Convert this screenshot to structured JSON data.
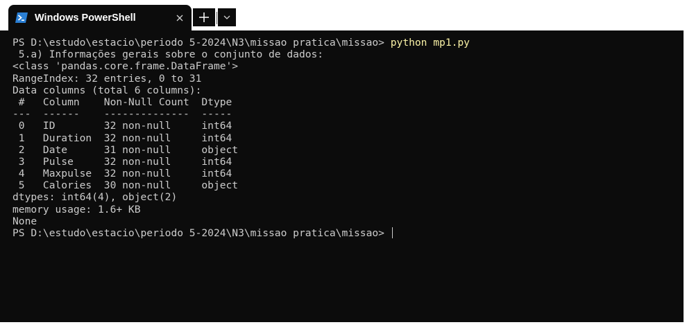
{
  "tab": {
    "title": "Windows PowerShell",
    "icon": "powershell-icon"
  },
  "colors": {
    "background": "#0c0c0c",
    "text": "#cccccc",
    "command": "#f9f1a5"
  },
  "terminal": {
    "prompt_path": "PS D:\\estudo\\estacio\\periodo 5-2024\\N3\\missao pratica\\missao> ",
    "command": "python mp1.py",
    "output": [
      " 5.a) Informações gerais sobre o conjunto de dados:",
      "<class 'pandas.core.frame.DataFrame'>",
      "RangeIndex: 32 entries, 0 to 31",
      "Data columns (total 6 columns):",
      " #   Column    Non-Null Count  Dtype ",
      "---  ------    --------------  ----- ",
      " 0   ID        32 non-null     int64 ",
      " 1   Duration  32 non-null     int64 ",
      " 2   Date      31 non-null     object",
      " 3   Pulse     32 non-null     int64 ",
      " 4   Maxpulse  32 non-null     int64 ",
      " 5   Calories  30 non-null     object",
      "dtypes: int64(4), object(2)",
      "memory usage: 1.6+ KB",
      "None"
    ],
    "final_prompt": "PS D:\\estudo\\estacio\\periodo 5-2024\\N3\\missao pratica\\missao> "
  }
}
